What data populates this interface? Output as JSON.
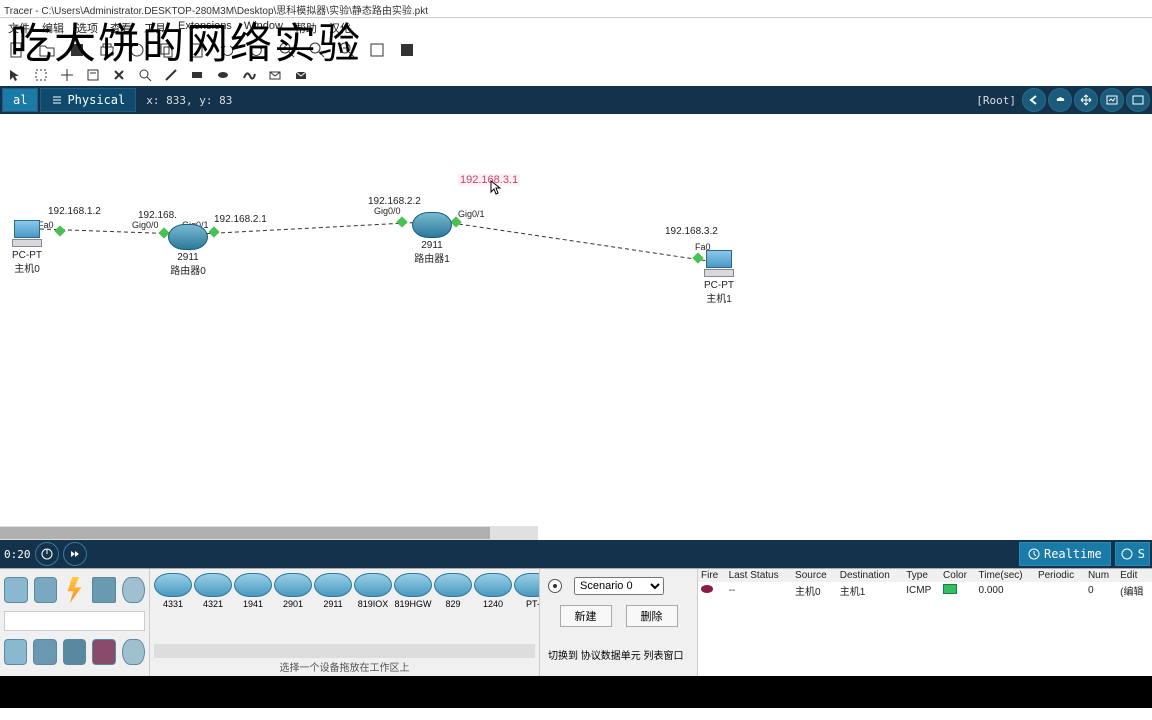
{
  "title": "Tracer - C:\\Users\\Administrator.DESKTOP-280M3M\\Desktop\\思科模拟器\\实验\\静态路由实验.pkt",
  "watermark": "吃大饼的网络实验",
  "menu": {
    "file": "文件",
    "edit": "编辑",
    "options": "选项",
    "view": "查看",
    "tools": "工具",
    "extensions": "Extensions",
    "window": "Window",
    "help": "帮助",
    "chinese": "汉化"
  },
  "viewtabs": {
    "logical": "al",
    "physical": "Physical"
  },
  "coords": "x: 833, y: 83",
  "root": "[Root]",
  "nodes": {
    "pc0": {
      "type": "PC-PT",
      "name": "主机0"
    },
    "router0": {
      "type": "2911",
      "name": "路由器0"
    },
    "router1": {
      "type": "2911",
      "name": "路由器1"
    },
    "pc1": {
      "type": "PC-PT",
      "name": "主机1"
    }
  },
  "ips": {
    "pc0": "192.168.1.2",
    "r0_left": "192.168.",
    "r0_right": "192.168.2.1",
    "r1_left": "192.168.2.2",
    "float": "192.168.3.1",
    "pc1": "192.168.3.2"
  },
  "ports": {
    "pc0": "Fa0",
    "r0_g00": "Gig0/0",
    "r0_g01": "Gig0/1",
    "r1_g00": "Gig0/0",
    "r1_g01": "Gig0/1",
    "pc1": "Fa0"
  },
  "time": "0:20",
  "realtime": "Realtime",
  "devicemodels": [
    "4331",
    "4321",
    "1941",
    "2901",
    "2911",
    "819IOX",
    "819HGW",
    "829",
    "1240",
    "PT-"
  ],
  "devicehint": "选择一个设备拖放在工作区上",
  "scenario": {
    "label": "Scenario 0",
    "new": "新建",
    "delete": "删除",
    "toggle": "切换到 协议数据单元 列表窗口"
  },
  "pdu": {
    "headers": [
      "Fire",
      "Last Status",
      "Source",
      "Destination",
      "Type",
      "Color",
      "Time(sec)",
      "Periodic",
      "Num",
      "Edit"
    ],
    "row": {
      "status": "--",
      "source": "主机0",
      "dest": "主机1",
      "type": "ICMP",
      "time": "0.000",
      "periodic": "",
      "num": "0",
      "edit": "(编辑"
    }
  }
}
